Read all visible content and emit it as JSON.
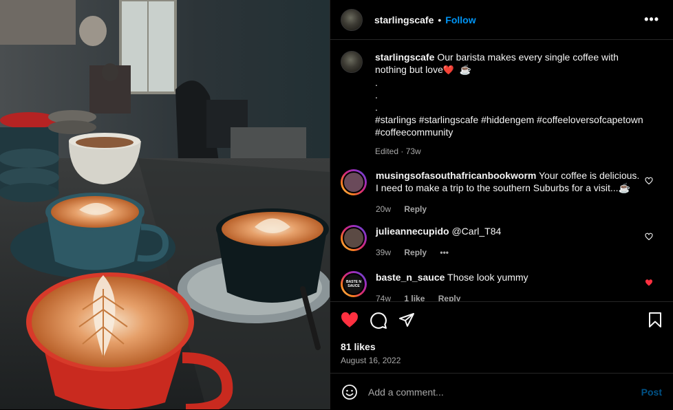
{
  "post": {
    "username": "starlingscafe",
    "follow_label": "Follow",
    "separator": "•",
    "more_label": "•••"
  },
  "caption": {
    "username": "starlingscafe",
    "text": "Our barista makes every single coffee with nothing but love",
    "heart_emoji": "❤️",
    "coffee_emoji": "☕",
    "dots": [
      ".",
      ".",
      "."
    ],
    "hashtags": "#starlings #starlingscafe #hiddengem #coffeeloversofcapetown #coffeecommunity",
    "meta": "Edited · 73w"
  },
  "comments": [
    {
      "username": "musingsofasouthafricanbookworm",
      "text": "Your coffee is delicious. I need to make a trip to the southern Suburbs for a visit...☕",
      "time": "20w",
      "likes": "",
      "reply_label": "Reply",
      "liked": false,
      "avatar_color": "#5a3a4a"
    },
    {
      "username": "julieannecupido",
      "text": "@Carl_T84",
      "time": "39w",
      "likes": "",
      "reply_label": "Reply",
      "extra": "•••",
      "liked": false,
      "avatar_color": "#4a3b35"
    },
    {
      "username": "baste_n_sauce",
      "text": "Those look yummy",
      "time": "74w",
      "likes": "1 like",
      "reply_label": "Reply",
      "liked": true,
      "avatar_color": "#111111",
      "avatar_text": "BASTE N SAUCE"
    }
  ],
  "engagement": {
    "likes": "81 likes",
    "date": "August 16, 2022",
    "liked": true
  },
  "add_comment": {
    "placeholder": "Add a comment...",
    "post_label": "Post"
  },
  "colors": {
    "accent": "#0095f6",
    "heart": "#ff3040",
    "muted": "#a8a8a8",
    "border": "#262626"
  }
}
